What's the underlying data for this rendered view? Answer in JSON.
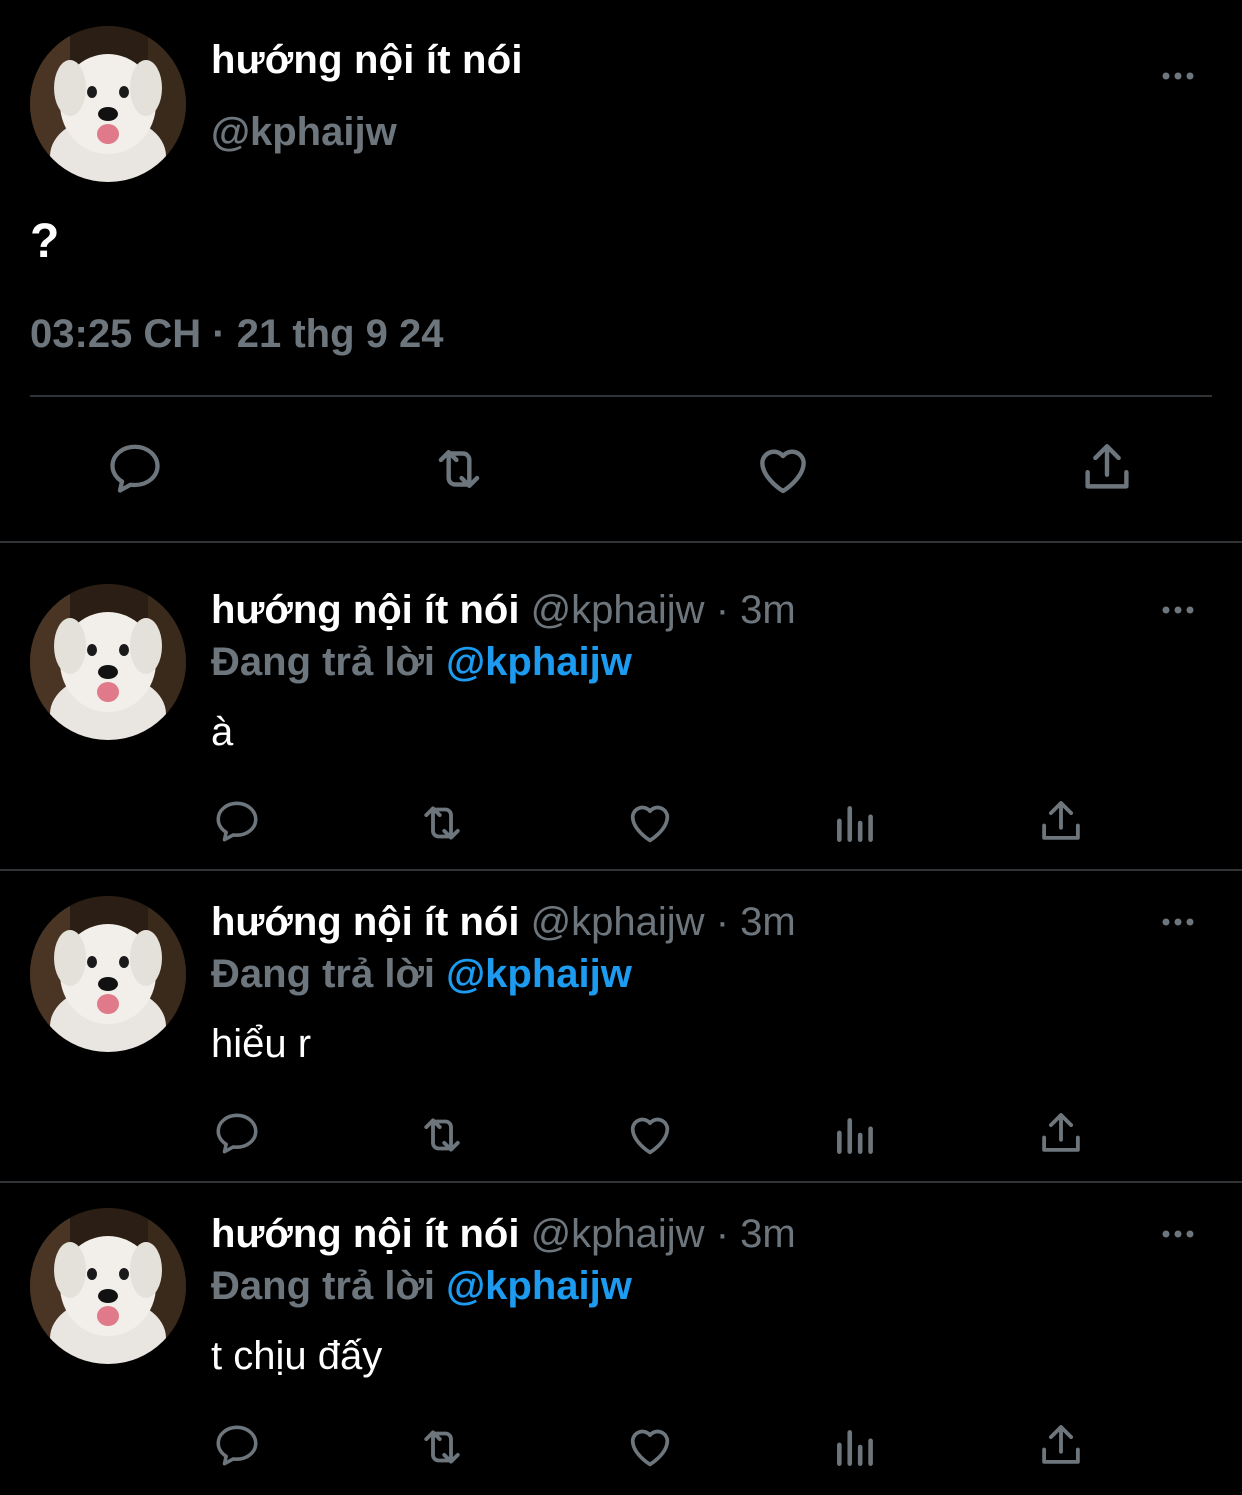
{
  "main_tweet": {
    "display_name": "hướng nội ít nói",
    "handle": "@kphaijw",
    "text": "?",
    "timestamp": "03:25 CH · 21 thg 9 24",
    "actions": [
      "reply-icon",
      "retweet-icon",
      "like-icon",
      "share-icon"
    ]
  },
  "replies": [
    {
      "display_name": "hướng nội ít nói",
      "handle": "@kphaijw",
      "time": "3m",
      "separator": "·",
      "replying_label": "Đang trả lời",
      "replying_to": "@kphaijw",
      "text": "à"
    },
    {
      "display_name": "hướng nội ít nói",
      "handle": "@kphaijw",
      "time": "3m",
      "separator": "·",
      "replying_label": "Đang trả lời",
      "replying_to": "@kphaijw",
      "text": "hiểu r"
    },
    {
      "display_name": "hướng nội ít nói",
      "handle": "@kphaijw",
      "time": "3m",
      "separator": "·",
      "replying_label": "Đang trả lời",
      "replying_to": "@kphaijw",
      "text": "t chịu đấy"
    }
  ],
  "colors": {
    "background": "#000000",
    "text": "#ffffff",
    "muted": "#6e767d",
    "link": "#1d9bf0",
    "divider": "#2f3336"
  }
}
